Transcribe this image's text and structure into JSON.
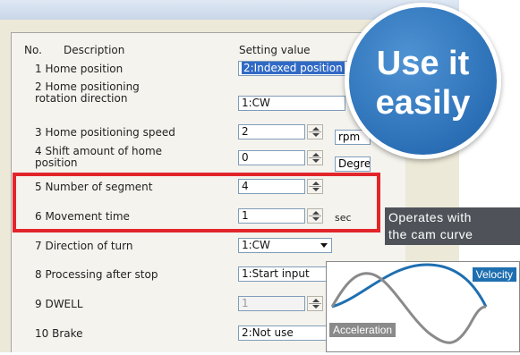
{
  "columns": {
    "no": "No.",
    "description": "Description",
    "setting": "Setting value"
  },
  "rows": [
    {
      "label": "1 Home position",
      "value": "2:Indexed position"
    },
    {
      "label": "2 Home positioning\nrotation direction",
      "value": "1:CW"
    },
    {
      "label": "3 Home positioning speed",
      "value": "2",
      "unit": "rpm"
    },
    {
      "label": "4 Shift amount of home\nposition",
      "value": "0",
      "unit": "Degree"
    },
    {
      "label": "5 Number of segment",
      "value": "4"
    },
    {
      "label": "6 Movement time",
      "value": "1",
      "unit": "sec"
    },
    {
      "label": "7 Direction of turn",
      "value": "1:CW"
    },
    {
      "label": "8 Processing after stop",
      "value": "1:Start input"
    },
    {
      "label": "9 DWELL",
      "value": "1"
    },
    {
      "label": "10 Brake",
      "value": "2:Not use"
    }
  ],
  "badge": {
    "line1": "Use it",
    "line2": "easily",
    "color": "#2b6fb6"
  },
  "caption": {
    "line1": "Operates with",
    "line2": "the cam curve"
  },
  "graph": {
    "velocity_label": "Velocity",
    "acceleration_label": "Acceleration",
    "velocity_color": "#1e6fb0",
    "acceleration_color": "#8a8a8a"
  },
  "highlight_color": "#e2252b"
}
